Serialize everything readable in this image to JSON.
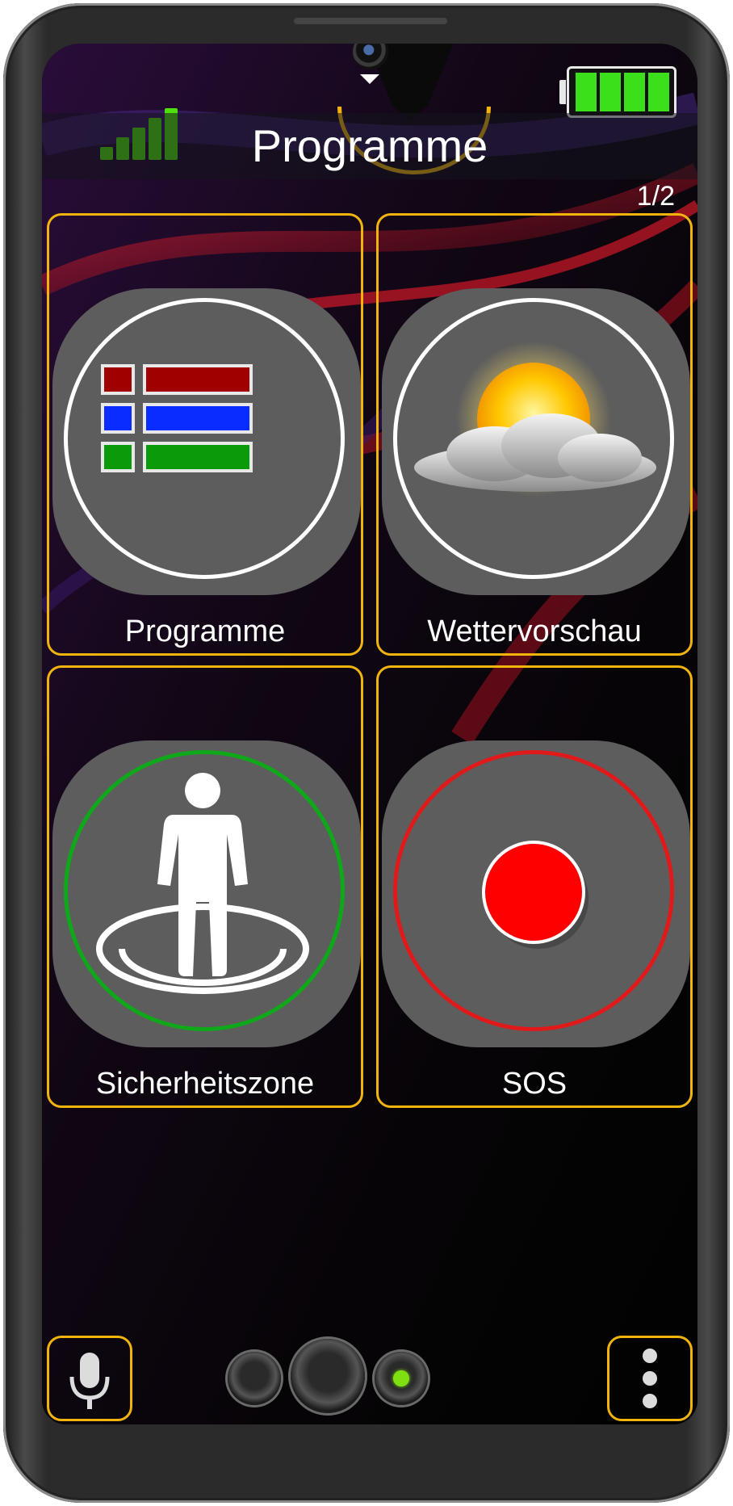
{
  "status_bar": {
    "signal_icon": "signal-strength-icon",
    "signal_bars": 5,
    "battery_icon": "battery-full-icon",
    "battery_cells": 4,
    "accent_color": "#4ee00f"
  },
  "header": {
    "title": "Programme",
    "page_indicator": "1/2"
  },
  "tiles": [
    {
      "label": "Programme",
      "icon": "programme-list-icon",
      "ring_color": "#ffffff"
    },
    {
      "label": "Wettervorschau",
      "icon": "weather-sun-cloud-icon",
      "ring_color": "#ffffff"
    },
    {
      "label": "Sicherheitszone",
      "icon": "safety-zone-person-icon",
      "ring_color": "#0fa81a"
    },
    {
      "label": "SOS",
      "icon": "sos-record-icon",
      "ring_color": "#e01a1a"
    }
  ],
  "bottom_bar": {
    "mic_icon": "microphone-icon",
    "menu_icon": "more-vertical-icon",
    "nav_dots": 3,
    "active_dot": 3
  },
  "colors": {
    "tile_border": "#f0b40c",
    "icon_background": "#5d5d5d"
  }
}
